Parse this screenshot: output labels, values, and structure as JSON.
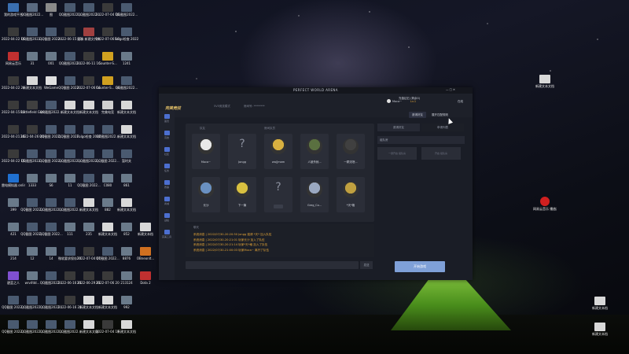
{
  "desktop": {
    "icons": [
      {
        "label": "我的游戏平台",
        "col": 0,
        "row": 0,
        "color": "#3a6fb0"
      },
      {
        "label": "QQ截图2022...",
        "col": 1,
        "row": 0,
        "color": "#5a6a80"
      },
      {
        "label": "图",
        "col": 2,
        "row": 0,
        "color": "#8a8a8a"
      },
      {
        "label": "QQ截图2022...",
        "col": 3,
        "row": 0,
        "color": "#4a5a70"
      },
      {
        "label": "QQ截图2022...",
        "col": 4,
        "row": 0,
        "color": "#4a5a70"
      },
      {
        "label": "2022-07-04 16-37-11",
        "col": 5,
        "row": 0,
        "color": "#3a3a3a"
      },
      {
        "label": "QQ截图2022...",
        "col": 6,
        "row": 0,
        "color": "#4a5a70"
      },
      {
        "label": "2022-04-22 16-12-42",
        "col": 0,
        "row": 1,
        "color": "#3a3a3a"
      },
      {
        "label": "QQ截图2022...",
        "col": 1,
        "row": 1,
        "color": "#4a5a70"
      },
      {
        "label": "QQ截图 2022...",
        "col": 2,
        "row": 1,
        "color": "#4a5a70"
      },
      {
        "label": "2022-06-15 15-17-42",
        "col": 3,
        "row": 1,
        "color": "#3a3a3a"
      },
      {
        "label": "图像 新建文件夹",
        "col": 4,
        "row": 1,
        "color": "#a04040"
      },
      {
        "label": "2022-07-06 16-15-06",
        "col": 5,
        "row": 1,
        "color": "#3a3a3a"
      },
      {
        "label": "Folgo检查 2022...",
        "col": 6,
        "row": 1,
        "color": "#4a5a70"
      },
      {
        "label": "网易云音乐",
        "col": 0,
        "row": 2,
        "color": "#c03030"
      },
      {
        "label": "31",
        "col": 1,
        "row": 2,
        "color": "#6a7a8a"
      },
      {
        "label": "001",
        "col": 2,
        "row": 2,
        "color": "#6a7a8a"
      },
      {
        "label": "QQ截图2022...",
        "col": 3,
        "row": 2,
        "color": "#4a5a70"
      },
      {
        "label": "2022-06-11 16-00-26",
        "col": 4,
        "row": 2,
        "color": "#3a3a3a"
      },
      {
        "label": "Counter-S...",
        "col": 5,
        "row": 2,
        "color": "#d0a020"
      },
      {
        "label": "1241",
        "col": 6,
        "row": 2,
        "color": "#6a7a8a"
      },
      {
        "label": "2022-04-22 20-05-00",
        "col": 0,
        "row": 3,
        "color": "#3a3a3a"
      },
      {
        "label": "新建文本文档",
        "col": 1,
        "row": 3,
        "color": "#d8d8d8"
      },
      {
        "label": "WeGame",
        "col": 2,
        "row": 3,
        "color": "#e0e0e0"
      },
      {
        "label": "QQ截图 2022...",
        "col": 3,
        "row": 3,
        "color": "#4a5a70"
      },
      {
        "label": "2022-07-06 16-55-01",
        "col": 4,
        "row": 3,
        "color": "#3a3a3a"
      },
      {
        "label": "Counter-S... Global Off...",
        "col": 5,
        "row": 3,
        "color": "#d0a020"
      },
      {
        "label": "QQ截图2022...",
        "col": 6,
        "row": 3,
        "color": "#4a5a70"
      },
      {
        "label": "2022-04-15 15-42-41",
        "col": 0,
        "row": 4,
        "color": "#3a3a3a"
      },
      {
        "label": "Battlefield Games Lau...",
        "col": 1,
        "row": 4,
        "color": "#404040"
      },
      {
        "label": "QQ截图2022...",
        "col": 2,
        "row": 4,
        "color": "#4a5a70"
      },
      {
        "label": "新建文本文档",
        "col": 3,
        "row": 4,
        "color": "#d8d8d8"
      },
      {
        "label": "新建文本文档",
        "col": 4,
        "row": 4,
        "color": "#d8d8d8"
      },
      {
        "label": "完美电竞",
        "col": 5,
        "row": 4,
        "color": "#d0d0d0"
      },
      {
        "label": "新建文本文档",
        "col": 6,
        "row": 4,
        "color": "#d8d8d8"
      },
      {
        "label": "2022-04-21 16-44-25",
        "col": 0,
        "row": 5,
        "color": "#3a3a3a"
      },
      {
        "label": "2022-04-26 20-11-03",
        "col": 1,
        "row": 5,
        "color": "#3a3a3a"
      },
      {
        "label": "QQ截图 2022...",
        "col": 2,
        "row": 5,
        "color": "#4a5a70"
      },
      {
        "label": "QQ截图 2022...",
        "col": 3,
        "row": 5,
        "color": "#4a5a70"
      },
      {
        "label": "Folgo检查 2022...",
        "col": 4,
        "row": 5,
        "color": "#4a5a70"
      },
      {
        "label": "QQ截图2022...",
        "col": 5,
        "row": 5,
        "color": "#4a5a70"
      },
      {
        "label": "新建文本文档",
        "col": 6,
        "row": 5,
        "color": "#d8d8d8"
      },
      {
        "label": "2022-04-22 15-29-00",
        "col": 0,
        "row": 6,
        "color": "#3a3a3a"
      },
      {
        "label": "QQ截图2022...",
        "col": 1,
        "row": 6,
        "color": "#4a5a70"
      },
      {
        "label": "QQ截图 2022...",
        "col": 2,
        "row": 6,
        "color": "#4a5a70"
      },
      {
        "label": "QQ截图2022...",
        "col": 3,
        "row": 6,
        "color": "#4a5a70"
      },
      {
        "label": "QQ截图2022...",
        "col": 4,
        "row": 6,
        "color": "#4a5a70"
      },
      {
        "label": "QQ截图 2022...",
        "col": 5,
        "row": 6,
        "color": "#4a5a70"
      },
      {
        "label": "暂时关",
        "col": 6,
        "row": 6,
        "color": "#4a5a70"
      },
      {
        "label": "雷电模拟器 online",
        "col": 0,
        "row": 7,
        "color": "#2070d0"
      },
      {
        "label": "1333",
        "col": 1,
        "row": 7,
        "color": "#6a7a8a"
      },
      {
        "label": "S6",
        "col": 2,
        "row": 7,
        "color": "#6a7a8a"
      },
      {
        "label": "11",
        "col": 3,
        "row": 7,
        "color": "#6a7a8a"
      },
      {
        "label": "QQ截图 2022...",
        "col": 4,
        "row": 7,
        "color": "#4a5a70"
      },
      {
        "label": "C080",
        "col": 5,
        "row": 7,
        "color": "#6a7a8a"
      },
      {
        "label": "861",
        "col": 6,
        "row": 7,
        "color": "#6a7a8a"
      },
      {
        "label": "399",
        "col": 0,
        "row": 8,
        "color": "#6a7a8a"
      },
      {
        "label": "QQ截图 2022...",
        "col": 1,
        "row": 8,
        "color": "#4a5a70"
      },
      {
        "label": "QQ截图2022...",
        "col": 2,
        "row": 8,
        "color": "#4a5a70"
      },
      {
        "label": "QQ截图2022...",
        "col": 3,
        "row": 8,
        "color": "#4a5a70"
      },
      {
        "label": "新建文本文档",
        "col": 4,
        "row": 8,
        "color": "#d8d8d8"
      },
      {
        "label": "882",
        "col": 5,
        "row": 8,
        "color": "#6a7a8a"
      },
      {
        "label": "新建文本文档",
        "col": 6,
        "row": 8,
        "color": "#d8d8d8"
      },
      {
        "label": "421",
        "col": 0,
        "row": 9,
        "color": "#6a7a8a"
      },
      {
        "label": "QQ截图 2022...",
        "col": 1,
        "row": 9,
        "color": "#4a5a70"
      },
      {
        "label": "QQ截图 2022...",
        "col": 2,
        "row": 9,
        "color": "#4a5a70"
      },
      {
        "label": "111",
        "col": 3,
        "row": 9,
        "color": "#6a7a8a"
      },
      {
        "label": "235",
        "col": 4,
        "row": 9,
        "color": "#6a7a8a"
      },
      {
        "label": "新建文本文档",
        "col": 5,
        "row": 9,
        "color": "#d8d8d8"
      },
      {
        "label": "852",
        "col": 6,
        "row": 9,
        "color": "#6a7a8a"
      },
      {
        "label": "新建文本档",
        "col": 7,
        "row": 9,
        "color": "#d8d8d8"
      },
      {
        "label": "214",
        "col": 0,
        "row": 10,
        "color": "#6a7a8a"
      },
      {
        "label": "12",
        "col": 1,
        "row": 10,
        "color": "#6a7a8a"
      },
      {
        "label": "14",
        "col": 2,
        "row": 10,
        "color": "#6a7a8a"
      },
      {
        "label": "微软要求保存2022...",
        "col": 3,
        "row": 10,
        "color": "#4a5a70"
      },
      {
        "label": "2022-07-04 17-22-00",
        "col": 4,
        "row": 10,
        "color": "#3a3a3a"
      },
      {
        "label": "QQ截图 2022...",
        "col": 5,
        "row": 10,
        "color": "#4a5a70"
      },
      {
        "label": "8876",
        "col": 6,
        "row": 10,
        "color": "#6a7a8a"
      },
      {
        "label": "OBneonlt...",
        "col": 7,
        "row": 10,
        "color": "#d07020"
      },
      {
        "label": "碧蓝之人",
        "col": 0,
        "row": 11,
        "color": "#8050d0"
      },
      {
        "label": "wrvifdd...",
        "col": 1,
        "row": 11,
        "color": "#6a7a8a"
      },
      {
        "label": "QQ截图2022...",
        "col": 2,
        "row": 11,
        "color": "#4a5a70"
      },
      {
        "label": "2022-06-16 21-05-00",
        "col": 3,
        "row": 11,
        "color": "#3a3a3a"
      },
      {
        "label": "2022-06-29 21-00-47",
        "col": 4,
        "row": 11,
        "color": "#3a3a3a"
      },
      {
        "label": "2022-07-06 20-00-47",
        "col": 5,
        "row": 11,
        "color": "#3a3a3a"
      },
      {
        "label": "213124",
        "col": 6,
        "row": 11,
        "color": "#6a7a8a"
      },
      {
        "label": "Dota 2",
        "col": 7,
        "row": 11,
        "color": "#c03030"
      },
      {
        "label": "QQ截图 2022...",
        "col": 0,
        "row": 12,
        "color": "#4a5a70"
      },
      {
        "label": "QQ截图2022...",
        "col": 1,
        "row": 12,
        "color": "#4a5a70"
      },
      {
        "label": "QQ截图2022...",
        "col": 2,
        "row": 12,
        "color": "#4a5a70"
      },
      {
        "label": "2022-06-16 21-04-41",
        "col": 3,
        "row": 12,
        "color": "#3a3a3a"
      },
      {
        "label": "新建文本文档",
        "col": 4,
        "row": 12,
        "color": "#d8d8d8"
      },
      {
        "label": "新建文本文档",
        "col": 5,
        "row": 12,
        "color": "#d8d8d8"
      },
      {
        "label": "992",
        "col": 6,
        "row": 12,
        "color": "#6a7a8a"
      },
      {
        "label": "QQ截图 2022...",
        "col": 0,
        "row": 13,
        "color": "#4a5a70"
      },
      {
        "label": "QQ截图2022...",
        "col": 1,
        "row": 13,
        "color": "#4a5a70"
      },
      {
        "label": "QQ截图2022...",
        "col": 2,
        "row": 13,
        "color": "#4a5a70"
      },
      {
        "label": "QQ截图2022...",
        "col": 3,
        "row": 13,
        "color": "#4a5a70"
      },
      {
        "label": "新建文本文档",
        "col": 4,
        "row": 13,
        "color": "#d8d8d8"
      },
      {
        "label": "2022-07-04 17-14-18",
        "col": 5,
        "row": 13,
        "color": "#3a3a3a"
      },
      {
        "label": "新建文本文档",
        "col": 6,
        "row": 13,
        "color": "#d8d8d8"
      }
    ],
    "right_icons": [
      {
        "label": "新建文本文档",
        "color": "#d8d8d8",
        "pos": "r1"
      },
      {
        "label": "网易云音乐 播放器 ",
        "color": "#d02020",
        "pos": "r2"
      },
      {
        "label": "新建文本档",
        "color": "#d8d8d8",
        "pos": "r3"
      },
      {
        "label": "新建文本档",
        "color": "#d8d8d8",
        "pos": "r4"
      }
    ]
  },
  "app": {
    "title": "PERFECT WORLD ARENA",
    "logo": "完美竞技",
    "mode_select": "5V5竞技模式",
    "room_select": "房间号: ********",
    "coins_label": "充值钻石 (剩余0)",
    "username": "Moca~",
    "level": "Lv.1",
    "status": "在线",
    "invite_button": "邀请好友",
    "quick_match_button": "展开匹配规则",
    "sidebar": [
      {
        "label": "首页",
        "color": "#4c6fd0"
      },
      {
        "label": "竞技",
        "color": "#4c6fd0"
      },
      {
        "label": "社区",
        "color": "#4c6fd0"
      },
      {
        "label": "任务",
        "color": "#4c6fd0"
      },
      {
        "label": "赛事",
        "color": "#4c6fd0"
      },
      {
        "label": "商城",
        "color": "#4c6fd0"
      },
      {
        "label": "战绩",
        "color": "#4c6fd0"
      },
      {
        "label": "完美工具",
        "color": "#4c6fd0"
      }
    ],
    "team_header": "队友",
    "room_header": "房间队员",
    "players": [
      {
        "name": "Moca~",
        "avatar": "#e8e8e8",
        "empty": false
      },
      {
        "name": "Jongg",
        "avatar": "",
        "empty": true
      },
      {
        "name": "waj[mam",
        "avatar": "#d8b040",
        "empty": false
      },
      {
        "name": "人被杀就...",
        "avatar": "#5a7040",
        "empty": false
      },
      {
        "name": "一颗流氓...",
        "avatar": "#404040",
        "empty": false
      },
      {
        "name": "长沙",
        "avatar": "#6a90c0",
        "empty": false
      },
      {
        "name": "下一篇",
        "avatar": "#d8c040",
        "empty": false
      },
      {
        "name": "",
        "avatar": "",
        "empty": true
      },
      {
        "name": "Greg_Co...",
        "avatar": "#9aa8c0",
        "empty": false
      },
      {
        "name": "*天*格",
        "avatar": "#c0a040",
        "empty": false
      }
    ],
    "log_header": "聊天",
    "log_lines": [
      "系统消息 | 2022/07/30-20:20:50 Jongg 邀请 *天* 加入队伍",
      "系统消息 | 2022/07/30-20:21:01 玩家长沙 加入了队伍",
      "系统消息 | 2022/07/30-20:21:14 玩家*天*格 加入了队伍",
      "系统消息 | 2022/07/30-21:00:03 玩家Moca~ 离开了队伍"
    ],
    "send_button": "发送",
    "right_tabs": [
      "邀请好友",
      "申请列表"
    ],
    "right_input_label": "组队房",
    "right_buttons": [
      "一键开启 组队房",
      "开启 组队房"
    ],
    "start_button": "开始游戏"
  }
}
